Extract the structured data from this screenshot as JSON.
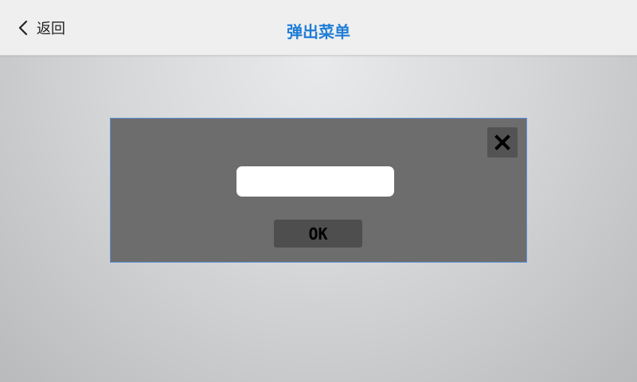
{
  "header": {
    "back_label": "返回",
    "back_icon": "chevron-left-icon",
    "title": "弹出菜单"
  },
  "dialog": {
    "close_icon": "close-icon",
    "input_value": "",
    "input_placeholder": "",
    "ok_label": "OK"
  },
  "colors": {
    "title": "#1f7ed6",
    "header_bg": "#efefef",
    "dialog_bg": "#6e6d6d",
    "dialog_border": "#5b8fd6",
    "ok_button_bg": "#4e4e4e",
    "close_button_bg": "#535353"
  }
}
